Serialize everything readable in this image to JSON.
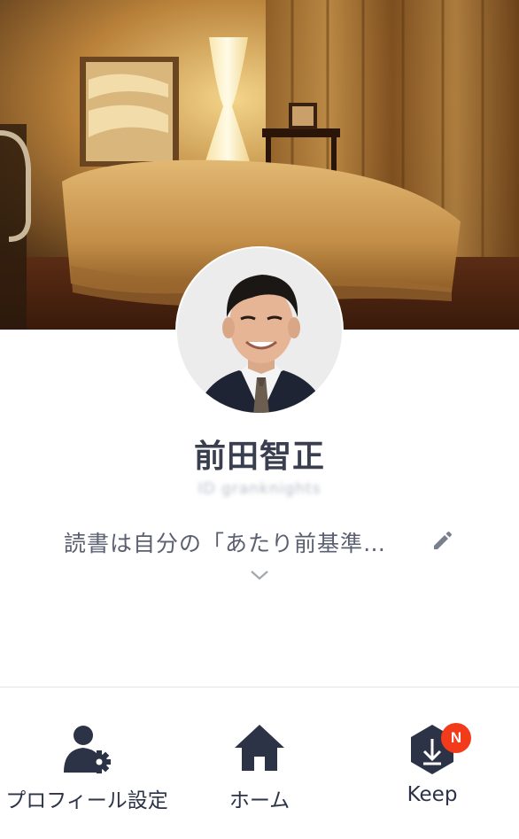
{
  "profile": {
    "name": "前田智正",
    "line_id": "ID  granknights",
    "status_message": "読書は自分の「あたり前基準…"
  },
  "actions": {
    "edit_icon": "pencil-icon",
    "expand_icon": "chevron-down-icon"
  },
  "bottom_nav": {
    "items": [
      {
        "label": "プロフィール設定",
        "icon": "user-settings-icon"
      },
      {
        "label": "ホーム",
        "icon": "home-icon"
      },
      {
        "label": "Keep",
        "icon": "keep-icon",
        "badge": "N"
      }
    ]
  },
  "colors": {
    "nav_icon": "#2c3347",
    "badge": "#f23b1b",
    "text_primary": "#3a3f50",
    "text_secondary": "#5b6070"
  }
}
